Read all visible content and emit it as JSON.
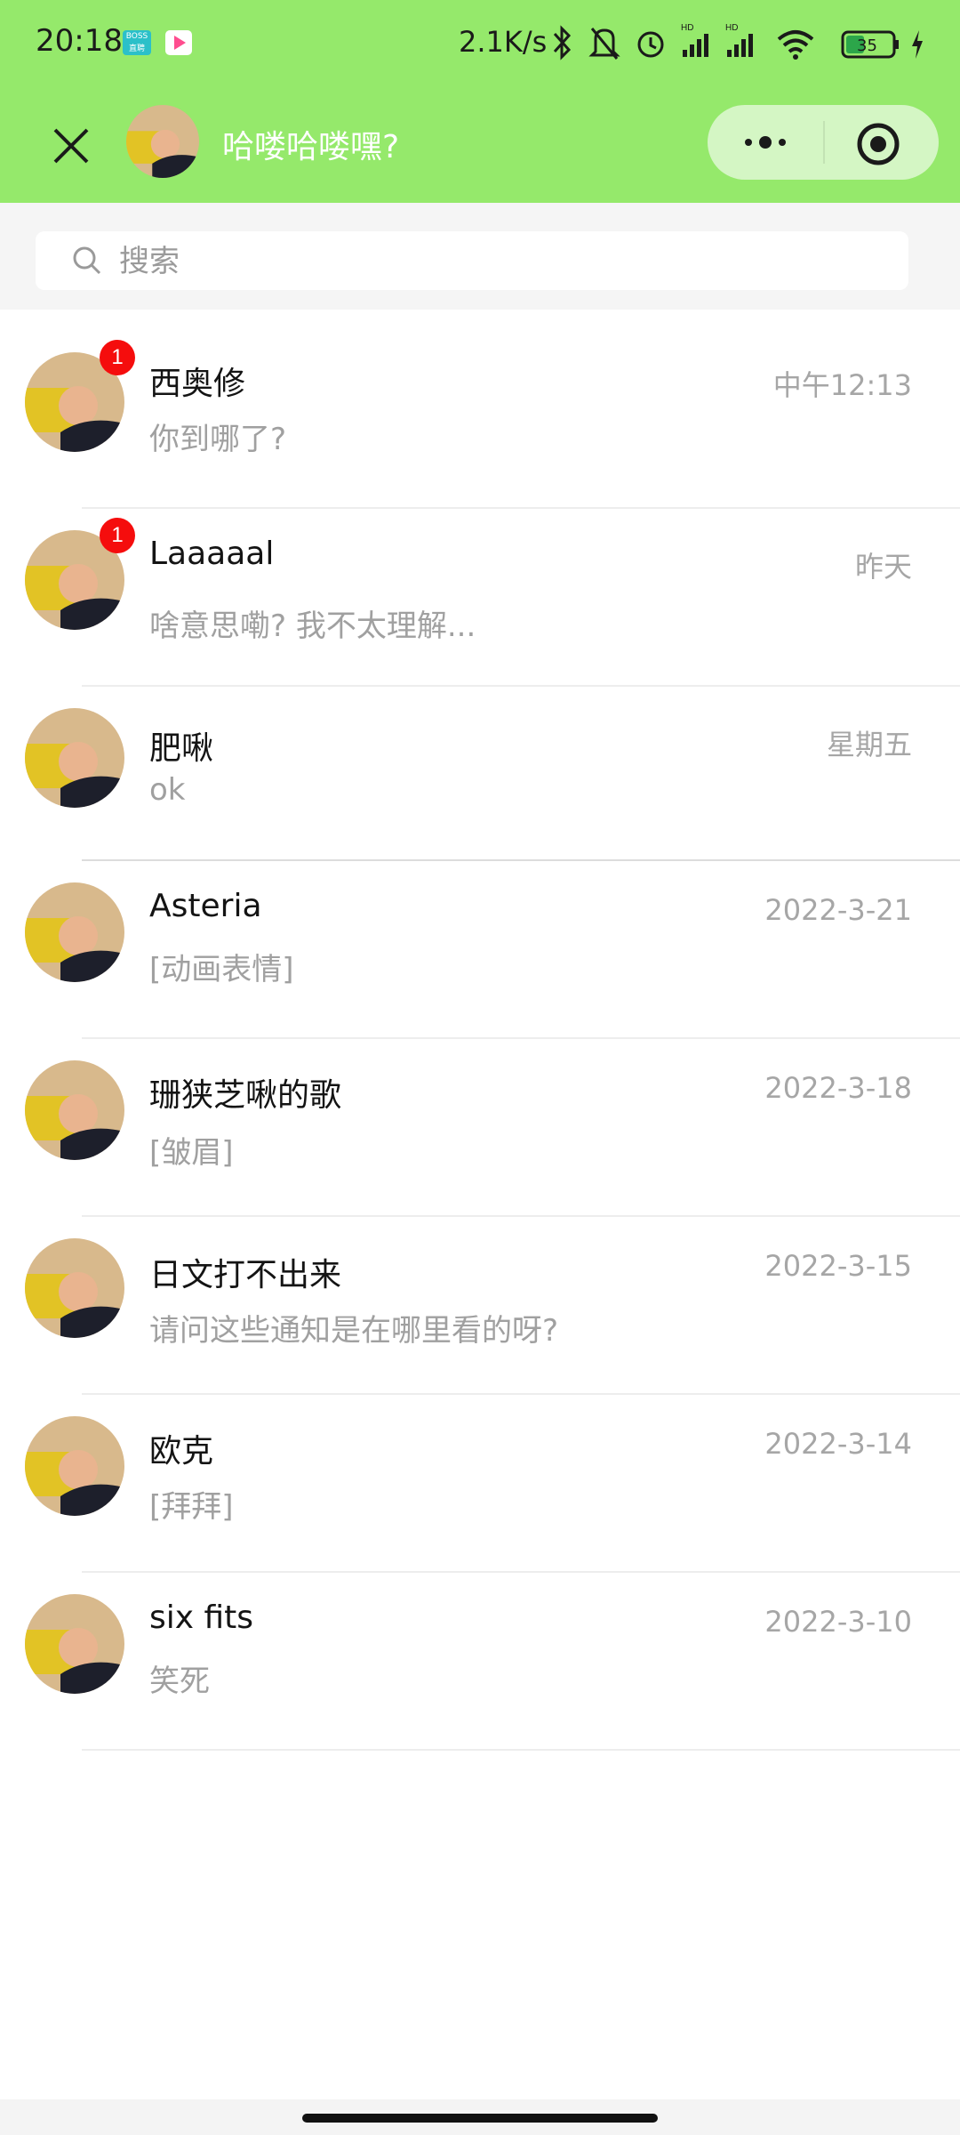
{
  "status_bar": {
    "time": "20:18",
    "app_icon_1": "boss-app-icon",
    "app_icon_2": "video-app-icon",
    "net_speed": "2.1K/s",
    "battery": "35"
  },
  "nav": {
    "title": "哈喽哈喽嘿?",
    "close_icon": "close-icon",
    "more_icon": "more-dots-icon",
    "record_icon": "target-icon",
    "header_color": "#95e96b"
  },
  "search": {
    "placeholder": "搜索",
    "value": ""
  },
  "conversations": [
    {
      "name": "西奥修",
      "time": "中午12:13",
      "message": "你到哪了?",
      "badge": "1"
    },
    {
      "name": "Laaaaal",
      "time": "昨天",
      "message": "啥意思嘞? 我不太理解...",
      "badge": "1"
    },
    {
      "name": "肥啾",
      "time": "星期五",
      "message": "ok",
      "badge": ""
    },
    {
      "name": "Asteria",
      "time": "2022-3-21",
      "message": "[动画表情]",
      "badge": ""
    },
    {
      "name": "珊狭芝啾的歌",
      "time": "2022-3-18",
      "message": "[皱眉]",
      "badge": ""
    },
    {
      "name": "日文打不出来",
      "time": "2022-3-15",
      "message": "请问这些通知是在哪里看的呀?",
      "badge": ""
    },
    {
      "name": "欧克",
      "time": "2022-3-14",
      "message": "[拜拜]",
      "badge": ""
    },
    {
      "name": "six fits",
      "time": "2022-3-10",
      "message": "笑死",
      "badge": ""
    }
  ]
}
